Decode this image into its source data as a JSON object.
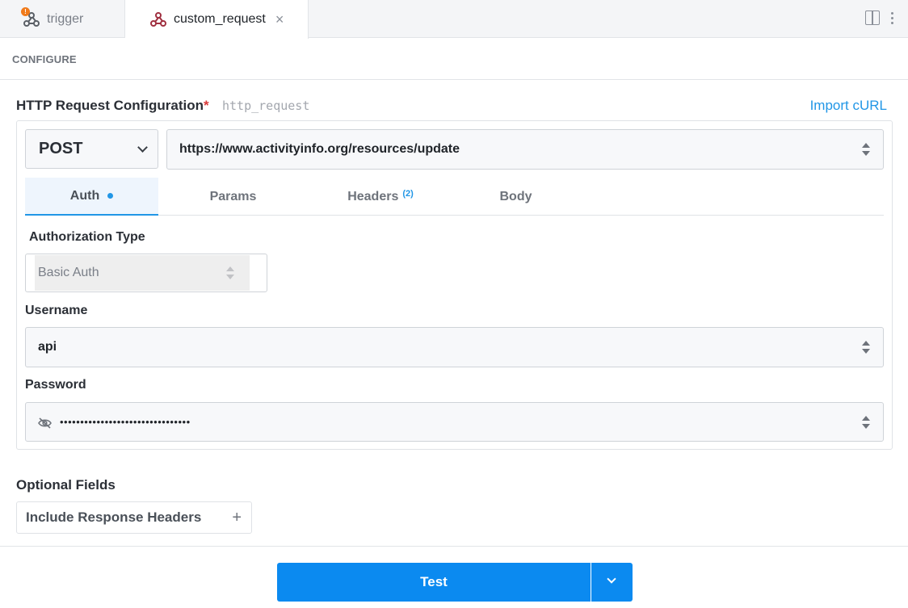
{
  "tabs": [
    {
      "label": "trigger",
      "badge": "!"
    },
    {
      "label": "custom_request",
      "close": "×"
    }
  ],
  "configure": {
    "title": "CONFIGURE"
  },
  "http_config": {
    "label": "HTTP Request Configuration",
    "required_mark": "*",
    "key": "http_request",
    "import_link": "Import cURL",
    "method": "POST",
    "url": "https://www.activityinfo.org/resources/update",
    "subtabs": [
      {
        "label": "Auth",
        "active": true,
        "indicator": "blue-dot"
      },
      {
        "label": "Params"
      },
      {
        "label": "Headers",
        "count": "(2)"
      },
      {
        "label": "Body"
      }
    ]
  },
  "auth": {
    "type_label": "Authorization Type",
    "type_value": "Basic Auth",
    "username_label": "Username",
    "username_value": "api",
    "password_label": "Password",
    "password_value": "••••••••••••••••••••••••••••••••"
  },
  "optional": {
    "title": "Optional Fields",
    "include_headers": "Include Response Headers",
    "plus": "+"
  },
  "actions": {
    "test": "Test"
  },
  "colors": {
    "accent": "#2196e6",
    "button": "#0b8af0",
    "badge": "#f07a1a",
    "required": "#d93838"
  }
}
